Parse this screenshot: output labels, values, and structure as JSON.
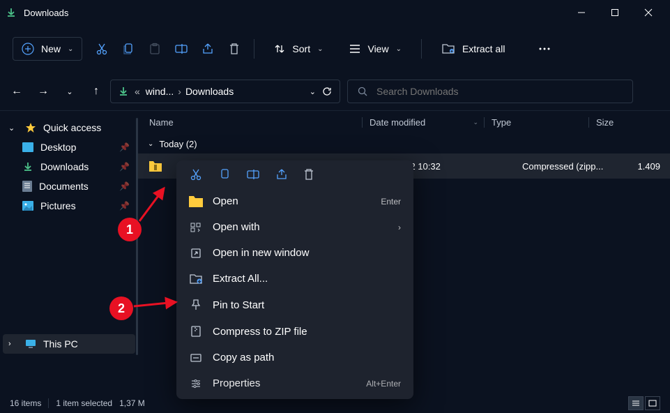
{
  "window": {
    "title": "Downloads"
  },
  "toolbar": {
    "new_label": "New",
    "sort_label": "Sort",
    "view_label": "View",
    "extract_label": "Extract all"
  },
  "address": {
    "segment1": "wind...",
    "segment2": "Downloads"
  },
  "search": {
    "placeholder": "Search Downloads"
  },
  "sidebar": {
    "quick_access": "Quick access",
    "items": [
      {
        "label": "Desktop"
      },
      {
        "label": "Downloads"
      },
      {
        "label": "Documents"
      },
      {
        "label": "Pictures"
      }
    ],
    "this_pc": "This PC"
  },
  "columns": {
    "name": "Name",
    "date": "Date modified",
    "type": "Type",
    "size": "Size"
  },
  "group": {
    "label": "Today (2)"
  },
  "file": {
    "date": "022 10:32",
    "type": "Compressed (zipp...",
    "size": "1.409"
  },
  "context": {
    "open": "Open",
    "open_shortcut": "Enter",
    "open_with": "Open with",
    "new_window": "Open in new window",
    "extract": "Extract All...",
    "pin": "Pin to Start",
    "compress": "Compress to ZIP file",
    "copy_path": "Copy as path",
    "properties": "Properties",
    "properties_shortcut": "Alt+Enter"
  },
  "annotations": {
    "one": "1",
    "two": "2"
  },
  "status": {
    "count": "16 items",
    "selected": "1 item selected",
    "size": "1,37 M"
  }
}
